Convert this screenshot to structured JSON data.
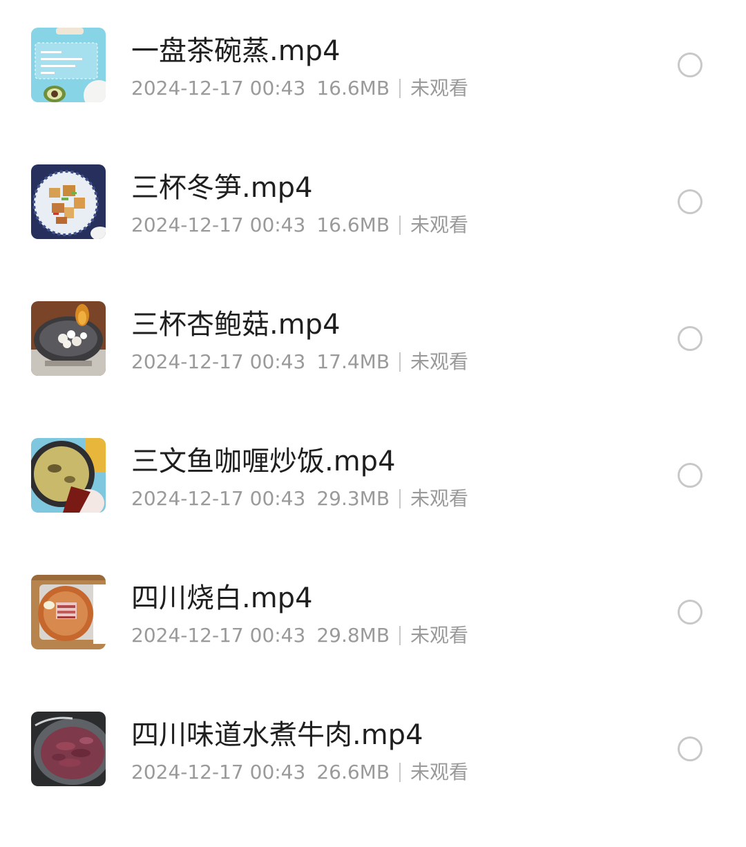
{
  "videos": [
    {
      "title": "一盘茶碗蒸.mp4",
      "date": "2024-12-17 00:43",
      "size": "16.6MB",
      "status": "未观看",
      "thumb_icon": "steamed-egg-recipe-card-thumbnail",
      "selected": false
    },
    {
      "title": "三杯冬笋.mp4",
      "date": "2024-12-17 00:43",
      "size": "16.6MB",
      "status": "未观看",
      "thumb_icon": "bamboo-shoot-dish-thumbnail",
      "selected": false
    },
    {
      "title": "三杯杏鲍菇.mp4",
      "date": "2024-12-17 00:43",
      "size": "17.4MB",
      "status": "未观看",
      "thumb_icon": "mushroom-wok-thumbnail",
      "selected": false
    },
    {
      "title": "三文鱼咖喱炒饭.mp4",
      "date": "2024-12-17 00:43",
      "size": "29.3MB",
      "status": "未观看",
      "thumb_icon": "curry-pan-thumbnail",
      "selected": false
    },
    {
      "title": "四川烧白.mp4",
      "date": "2024-12-17 00:43",
      "size": "29.8MB",
      "status": "未观看",
      "thumb_icon": "pork-belly-bowl-thumbnail",
      "selected": false
    },
    {
      "title": "四川味道水煮牛肉.mp4",
      "date": "2024-12-17 00:43",
      "size": "26.6MB",
      "status": "未观看",
      "thumb_icon": "sliced-beef-bowl-thumbnail",
      "selected": false
    }
  ],
  "colors": {
    "title": "#1f1f1f",
    "meta": "#9a9a9a",
    "radio_border": "#c8c8c8",
    "background": "#ffffff"
  }
}
